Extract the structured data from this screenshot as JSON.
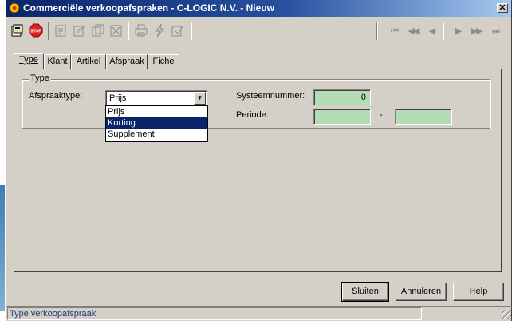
{
  "window": {
    "title": "Commerciële verkoopafspraken - C-LOGIC N.V. - Nieuw",
    "close_glyph": "✕"
  },
  "toolbar": {
    "left_icons": [
      "new-record-icon",
      "stop-icon",
      "edit-icon",
      "edit-doc-icon",
      "copy-icon",
      "delete-icon",
      "print-icon",
      "lightning-icon",
      "approve-icon"
    ],
    "nav": {
      "first": "⏮",
      "prev_page": "◀◀",
      "prev": "◀",
      "next": "▶",
      "next_page": "▶▶",
      "last": "⏭"
    }
  },
  "tabs": [
    "Type",
    "Klant",
    "Artikel",
    "Afspraak",
    "Fiche"
  ],
  "form": {
    "group_title": "Type",
    "afspraaktype_label": "Afspraaktype:",
    "afspraaktype_value": "Prijs",
    "afspraaktype_options": [
      "Prijs",
      "Korting",
      "Supplement"
    ],
    "highlighted_option": "Korting",
    "systeemnummer_label": "Systeemnummer:",
    "systeemnummer_value": "0",
    "periode_label": "Periode:",
    "periode_separator": "-",
    "periode_from": "",
    "periode_to": ""
  },
  "buttons": {
    "sluiten": "Sluiten",
    "annuleren": "Annuleren",
    "help": "Help"
  },
  "status": {
    "text": "Type verkoopafspraak"
  },
  "colors": {
    "titlebar_start": "#0a246a",
    "titlebar_end": "#a6caf0",
    "field_green": "#b4dcb4",
    "face": "#d4d0c8"
  }
}
